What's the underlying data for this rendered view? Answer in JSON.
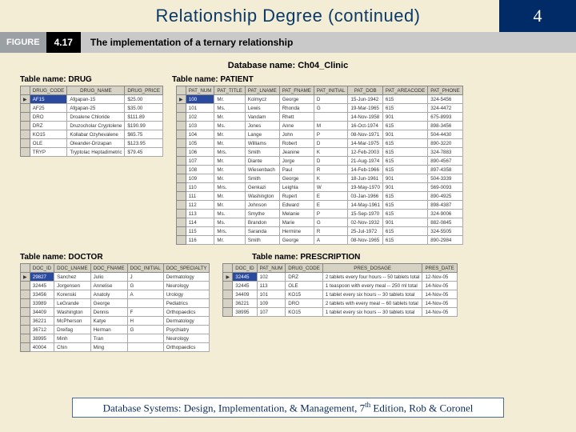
{
  "title": "Relationship Degree (continued)",
  "chapter": "4",
  "figure": {
    "label": "FIGURE",
    "num": "4.17",
    "caption": "The implementation of a ternary relationship"
  },
  "dbname_label": "Database name: Ch04_Clinic",
  "labels": {
    "drug": "Table name: DRUG",
    "patient": "Table name: PATIENT",
    "doctor": "Table name: DOCTOR",
    "prescription": "Table name: PRESCRIPTION"
  },
  "drug": {
    "headers": [
      "DRUG_CODE",
      "DRUG_NAME",
      "DRUG_PRICE"
    ],
    "rows": [
      [
        "AF15",
        "Afgapan-15",
        "$25.00"
      ],
      [
        "AF25",
        "Afgapan-25",
        "$35.00"
      ],
      [
        "DRO",
        "Droalene Chloride",
        "$111.89"
      ],
      [
        "DRZ",
        "Druzocholar Cryptolene",
        "$190.99"
      ],
      [
        "KO15",
        "Kollabar Ozyhevalene",
        "$65.75"
      ],
      [
        "OLE",
        "Oleander-Drizapan",
        "$123.95"
      ],
      [
        "TRYP",
        "Tryptolac Heptadimetric",
        "$79.45"
      ]
    ]
  },
  "patient": {
    "headers": [
      "PAT_NUM",
      "PAT_TITLE",
      "PAT_LNAME",
      "PAT_FNAME",
      "PAT_INITIAL",
      "PAT_DOB",
      "PAT_AREACODE",
      "PAT_PHONE"
    ],
    "rows": [
      [
        "100",
        "Mr.",
        "Kolmycz",
        "George",
        "D",
        "15-Jun-1942",
        "615",
        "324-5456"
      ],
      [
        "101",
        "Ms.",
        "Lewis",
        "Rhonda",
        "G",
        "19-Mar-1965",
        "615",
        "324-4472"
      ],
      [
        "102",
        "Mr.",
        "Vandam",
        "Rhett",
        "",
        "14-Nov-1958",
        "901",
        "675-8993"
      ],
      [
        "103",
        "Ms.",
        "Jones",
        "Anne",
        "M",
        "16-Oct-1974",
        "615",
        "898-3456"
      ],
      [
        "104",
        "Mr.",
        "Lange",
        "John",
        "P",
        "08-Nov-1971",
        "901",
        "504-4430"
      ],
      [
        "105",
        "Mr.",
        "Williams",
        "Robert",
        "D",
        "14-Mar-1975",
        "615",
        "890-3220"
      ],
      [
        "106",
        "Mrs.",
        "Smith",
        "Jeanine",
        "K",
        "12-Feb-2003",
        "615",
        "324-7883"
      ],
      [
        "107",
        "Mr.",
        "Diante",
        "Jorge",
        "D",
        "21-Aug-1974",
        "615",
        "890-4567"
      ],
      [
        "108",
        "Mr.",
        "Wiesenbach",
        "Paul",
        "R",
        "14-Feb-1966",
        "615",
        "897-4358"
      ],
      [
        "109",
        "Mr.",
        "Smith",
        "George",
        "K",
        "18-Jun-1961",
        "901",
        "504-3339"
      ],
      [
        "110",
        "Mrs.",
        "Genkazi",
        "Leighla",
        "W",
        "19-May-1970",
        "901",
        "569-0093"
      ],
      [
        "111",
        "Mr.",
        "Washington",
        "Rupert",
        "E",
        "03-Jan-1966",
        "615",
        "890-4925"
      ],
      [
        "112",
        "Mr.",
        "Johnson",
        "Edward",
        "E",
        "14-May-1961",
        "615",
        "898-4387"
      ],
      [
        "113",
        "Ms.",
        "Smythe",
        "Melanie",
        "P",
        "15-Sep-1970",
        "615",
        "324-9006"
      ],
      [
        "114",
        "Ms.",
        "Brandon",
        "Marie",
        "G",
        "02-Nov-1932",
        "901",
        "882-0845"
      ],
      [
        "115",
        "Mrs.",
        "Saranda",
        "Hermine",
        "R",
        "25-Jul-1972",
        "615",
        "324-5505"
      ],
      [
        "116",
        "Mr.",
        "Smith",
        "George",
        "A",
        "08-Nov-1965",
        "615",
        "890-2984"
      ]
    ]
  },
  "doctor": {
    "headers": [
      "DOC_ID",
      "DOC_LNAME",
      "DOC_FNAME",
      "DOC_INITIAL",
      "DOC_SPECIALTY"
    ],
    "rows": [
      [
        "29827",
        "Sanchez",
        "Julio",
        "J",
        "Dermatology"
      ],
      [
        "32445",
        "Jorgensen",
        "Annelise",
        "G",
        "Neurology"
      ],
      [
        "33456",
        "Korenski",
        "Anatoly",
        "A",
        "Urology"
      ],
      [
        "33989",
        "LeGrande",
        "George",
        "",
        "Pediatrics"
      ],
      [
        "34409",
        "Washington",
        "Dennis",
        "F",
        "Orthopaedics"
      ],
      [
        "36221",
        "McPherson",
        "Katye",
        "H",
        "Dermatology"
      ],
      [
        "36712",
        "Dreifag",
        "Herman",
        "G",
        "Psychiatry"
      ],
      [
        "38995",
        "Minh",
        "Tran",
        "",
        "Neurology"
      ],
      [
        "40004",
        "Chin",
        "Ming",
        "",
        "Orthopaedics"
      ]
    ]
  },
  "prescription": {
    "headers": [
      "DOC_ID",
      "PAT_NUM",
      "DRUG_CODE",
      "PRES_DOSAGE",
      "PRES_DATE"
    ],
    "rows": [
      [
        "32445",
        "102",
        "DRZ",
        "2 tablets every four hours -- 50 tablets total",
        "12-Nov-05"
      ],
      [
        "32445",
        "113",
        "OLE",
        "1 teaspoon with every meal -- 250 ml total",
        "14-Nov-05"
      ],
      [
        "34409",
        "101",
        "KO15",
        "1 tablet every six hours -- 30 tablets total",
        "14-Nov-05"
      ],
      [
        "36221",
        "109",
        "DRO",
        "2 tablets with every meal -- 60 tablets total",
        "14-Nov-05"
      ],
      [
        "38995",
        "107",
        "KO15",
        "1 tablet every six hours -- 30 tablets total",
        "14-Nov-05"
      ]
    ]
  },
  "footer": {
    "prefix": "Database Systems: Design, Implementation, & Management, 7",
    "sup": "th",
    "suffix": " Edition, Rob & Coronel"
  }
}
